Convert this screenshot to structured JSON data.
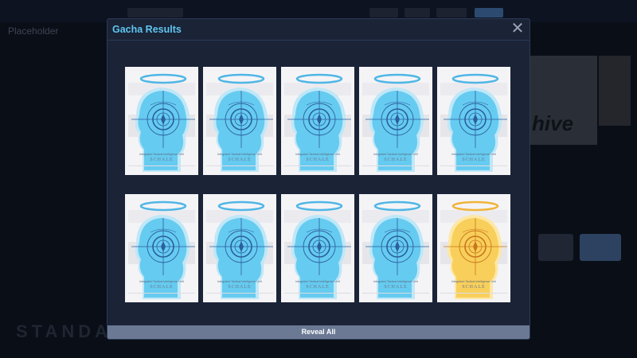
{
  "modal": {
    "title": "Gacha Results",
    "close_label": "✕",
    "reveal_label": "Reveal All"
  },
  "cards": [
    {
      "rarity": "common",
      "color": "#5cc8ee",
      "caption": "Integrated Tactical Intelligence Unit",
      "name": "SCHALE"
    },
    {
      "rarity": "common",
      "color": "#5cc8ee",
      "caption": "Integrated Tactical Intelligence Unit",
      "name": "SCHALE"
    },
    {
      "rarity": "common",
      "color": "#5cc8ee",
      "caption": "Integrated Tactical Intelligence Unit",
      "name": "SCHALE"
    },
    {
      "rarity": "common",
      "color": "#5cc8ee",
      "caption": "Integrated Tactical Intelligence Unit",
      "name": "SCHALE"
    },
    {
      "rarity": "common",
      "color": "#5cc8ee",
      "caption": "Integrated Tactical Intelligence Unit",
      "name": "SCHALE"
    },
    {
      "rarity": "common",
      "color": "#5cc8ee",
      "caption": "Integrated Tactical Intelligence Unit",
      "name": "SCHALE"
    },
    {
      "rarity": "common",
      "color": "#5cc8ee",
      "caption": "Integrated Tactical Intelligence Unit",
      "name": "SCHALE"
    },
    {
      "rarity": "common",
      "color": "#5cc8ee",
      "caption": "Integrated Tactical Intelligence Unit",
      "name": "SCHALE"
    },
    {
      "rarity": "common",
      "color": "#5cc8ee",
      "caption": "Integrated Tactical Intelligence Unit",
      "name": "SCHALE"
    },
    {
      "rarity": "rare",
      "color": "#f7cc52",
      "caption": "Integrated Tactical Intelligence Unit",
      "name": "SCHALE"
    }
  ],
  "background": {
    "page_title": "Placeholder",
    "banner_text": "hive",
    "footer_text": "STANDA"
  },
  "colors": {
    "accent": "#5fc6ee",
    "modal_bg": "#1b2337",
    "button_bg": "#6b7994",
    "common_card": "#5cc8ee",
    "rare_card": "#f7cc52"
  }
}
